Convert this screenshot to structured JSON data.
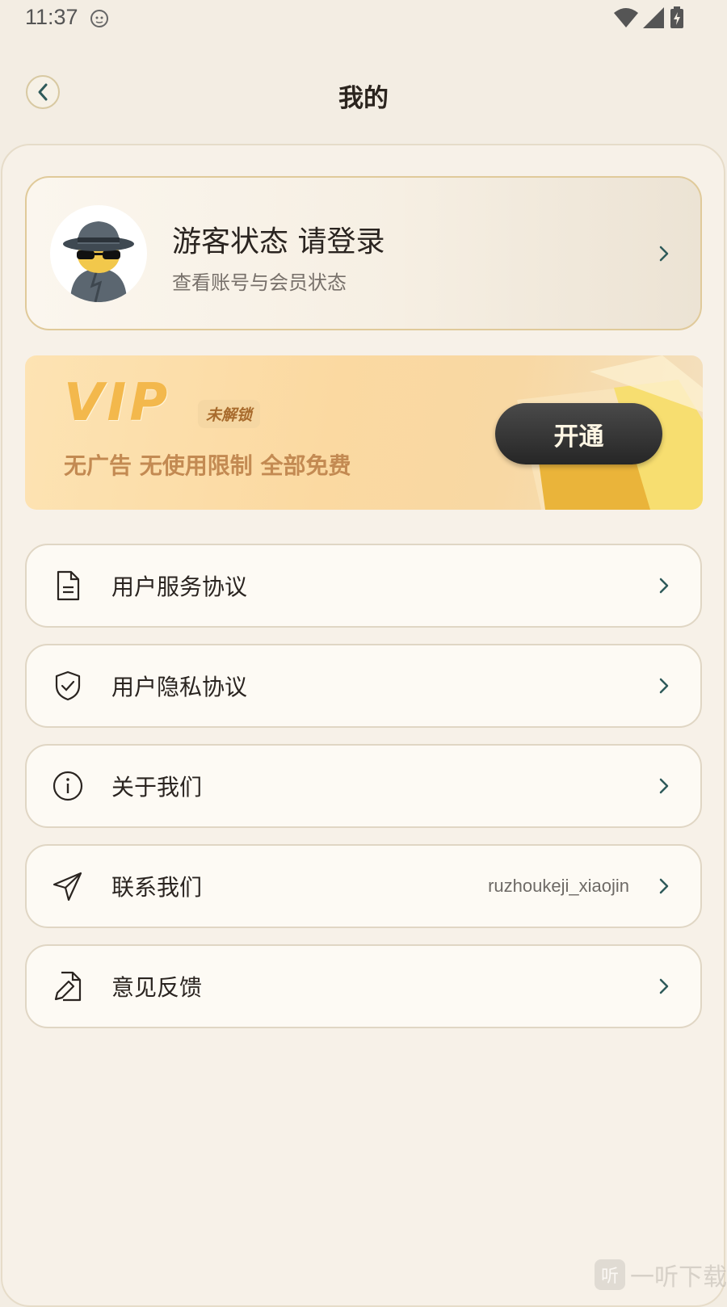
{
  "status_bar": {
    "time": "11:37"
  },
  "header": {
    "title": "我的"
  },
  "profile": {
    "name": "游客状态 请登录",
    "subtitle": "查看账号与会员状态"
  },
  "vip": {
    "title": "VIP",
    "badge": "未解锁",
    "description": "无广告 无使用限制 全部免费",
    "button_label": "开通"
  },
  "menu": [
    {
      "label": "用户服务协议",
      "icon": "document-icon",
      "value": ""
    },
    {
      "label": "用户隐私协议",
      "icon": "shield-check-icon",
      "value": ""
    },
    {
      "label": "关于我们",
      "icon": "info-icon",
      "value": ""
    },
    {
      "label": "联系我们",
      "icon": "paper-plane-icon",
      "value": "ruzhoukeji_xiaojin"
    },
    {
      "label": "意见反馈",
      "icon": "edit-file-icon",
      "value": ""
    }
  ],
  "watermark": {
    "icon_char": "听",
    "text": "一听下载"
  },
  "colors": {
    "accent": "#f3b84c",
    "vip_button": "#2b2b2b",
    "background": "#f3ede3"
  }
}
